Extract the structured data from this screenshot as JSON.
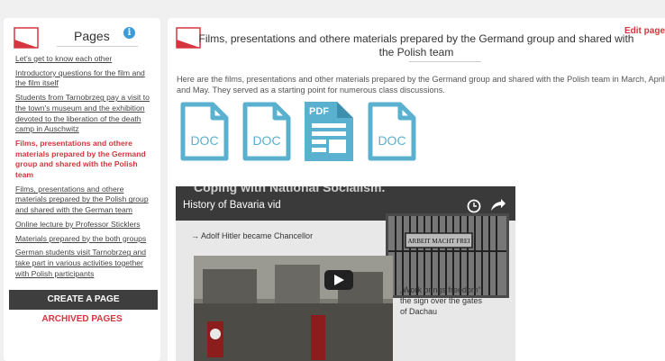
{
  "sidebar": {
    "title": "Pages",
    "info": "i",
    "items": [
      {
        "label": "Let's get to know each other",
        "active": false
      },
      {
        "label": "Introductory questions for the film and the film itself",
        "active": false
      },
      {
        "label": "Students from Tarnobrzeg pay a visit to the town's museum and the exhibition devoted to the liberation of the death camp in Auschwitz",
        "active": false
      },
      {
        "label": "Films, presentations and othere materials prepared by the Germand group and shared with the Polish team",
        "active": true
      },
      {
        "label": "Films, presentations and othere materials prepared by the Polish group and shared with the German team",
        "active": false
      },
      {
        "label": "Online lecture by Professor Sticklers",
        "active": false
      },
      {
        "label": "Materials prepared by the both groups",
        "active": false
      },
      {
        "label": "German students visit Tarnobrzeg and take part in various activities together with Polish participants",
        "active": false
      }
    ],
    "create_label": "CREATE A PAGE",
    "archived_label": "ARCHIVED PAGES"
  },
  "main": {
    "title": "Films, presentations and othere materials prepared by the Germand group and shared with the Polish team",
    "edit_label": "Edit page",
    "intro": "Here are the films, presentations and other materials prepared by the Germand group and shared with the Polish team in March, April and May. They served as a starting point for numerous class discussions.",
    "files": [
      {
        "type": "DOC",
        "icon": "doc-file-icon"
      },
      {
        "type": "DOC",
        "icon": "doc-file-icon"
      },
      {
        "type": "PDF",
        "icon": "pdf-file-icon"
      },
      {
        "type": "DOC",
        "icon": "doc-file-icon"
      }
    ]
  },
  "video": {
    "top_text": "Coping with National Socialism.",
    "title": "History of Bavaria vid",
    "bullet": "→ Adolf Hitler became Chancellor",
    "gate_sign": "ARBEIT MACHT FREI",
    "caption": "„Work brings freedom“ the sign over the gates of Dachau"
  },
  "colors": {
    "accent": "#d5363f",
    "file_blue": "#5ab0cf",
    "dark_button": "#3e3e3e"
  }
}
